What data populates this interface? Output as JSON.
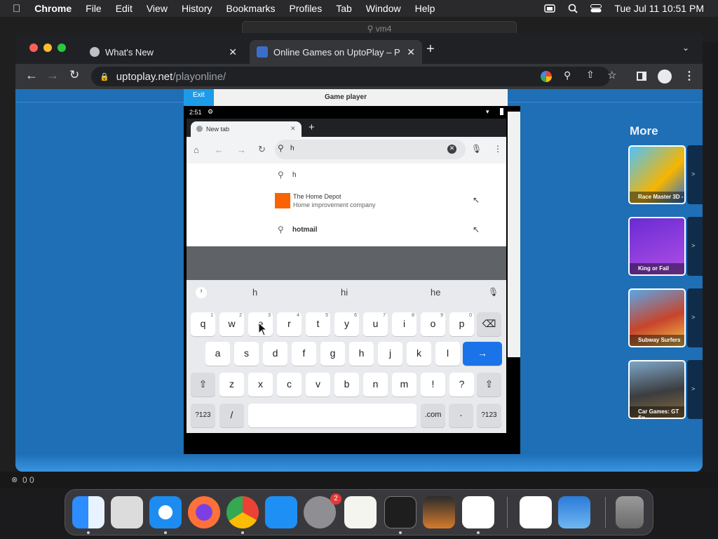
{
  "menubar": {
    "app": "Chrome",
    "items": [
      "File",
      "Edit",
      "View",
      "History",
      "Bookmarks",
      "Profiles",
      "Tab",
      "Window",
      "Help"
    ],
    "clock": "Tue Jul 11  10:51 PM"
  },
  "vscode": {
    "search_text": "vm4",
    "status": "0  0"
  },
  "chrome": {
    "tabs": [
      {
        "title": "What's New"
      },
      {
        "title": "Online Games on UptoPlay – P"
      }
    ],
    "url_host": "uptoplay.net",
    "url_path": "/playonline/"
  },
  "player": {
    "exit_label": "Exit",
    "title": "Game player"
  },
  "android": {
    "time": "2:51",
    "tab_title": "New tab",
    "query": "h",
    "suggestions": [
      {
        "title": "h",
        "sub": ""
      },
      {
        "title": "The Home Depot",
        "sub": "Home improvement company"
      },
      {
        "title": "hotmail",
        "sub": ""
      }
    ],
    "predictions": [
      "h",
      "hi",
      "he"
    ],
    "keys_row1": [
      "q",
      "w",
      "e",
      "r",
      "t",
      "y",
      "u",
      "i",
      "o",
      "p"
    ],
    "keys_row1_hints": [
      "1",
      "2",
      "3",
      "4",
      "5",
      "6",
      "7",
      "8",
      "9",
      "0"
    ],
    "keys_row2": [
      "a",
      "s",
      "d",
      "f",
      "g",
      "h",
      "j",
      "k",
      "l"
    ],
    "keys_row3": [
      "z",
      "x",
      "c",
      "v",
      "b",
      "n",
      "m",
      "!",
      "?"
    ],
    "bottom_row": {
      "sym": "?123",
      "slash": "/",
      "com": ".com",
      "dot": "·",
      "sym2": "?123"
    }
  },
  "more": {
    "title": "More",
    "games": [
      "Race Master 3D -",
      "King or Fail",
      "Subway Surfers",
      "Car Games: GT Sp"
    ]
  },
  "dock": {
    "badge": "2"
  },
  "colors": {
    "page_bg": "#1e6fb6",
    "accent_blue": "#1a73e8",
    "exit_blue": "#1e9be8"
  }
}
